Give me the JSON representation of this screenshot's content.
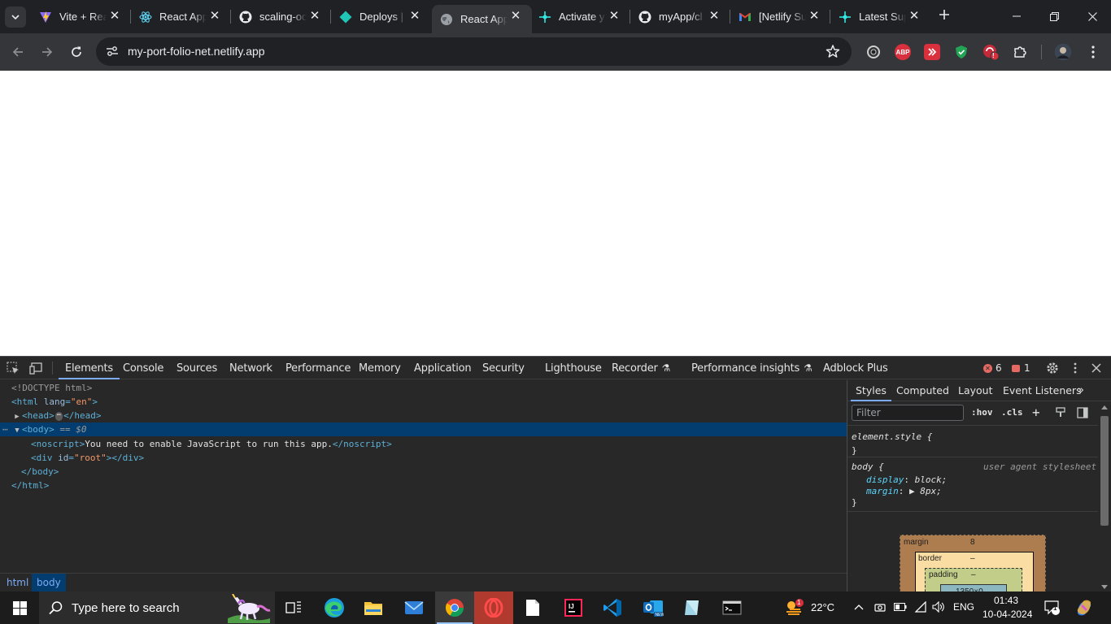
{
  "browser": {
    "tabs": [
      {
        "title": "Vite + React",
        "icon": "vite-icon",
        "active": false
      },
      {
        "title": "React App",
        "icon": "react-icon",
        "active": false
      },
      {
        "title": "scaling-octo",
        "icon": "github-icon",
        "active": false
      },
      {
        "title": "Deploys | ",
        "icon": "netlify-icon",
        "active": false
      },
      {
        "title": "React App",
        "icon": "globe-icon",
        "active": true
      },
      {
        "title": "Activate y",
        "icon": "netlify-sparkle-icon",
        "active": false
      },
      {
        "title": "myApp/cl",
        "icon": "github-icon",
        "active": false
      },
      {
        "title": "[Netlify Su",
        "icon": "gmail-icon",
        "active": false
      },
      {
        "title": "Latest Sup",
        "icon": "netlify-sparkle-icon",
        "active": false
      }
    ],
    "url": "my-port-folio-net.netlify.app",
    "extensions": [
      {
        "name": "profile-ext-icon",
        "label": ""
      },
      {
        "name": "adblock-plus-icon",
        "label": "ABP"
      },
      {
        "name": "red-ext-icon",
        "label": ""
      },
      {
        "name": "shield-ext-icon",
        "label": ""
      },
      {
        "name": "alert-ext-icon",
        "label": "!"
      },
      {
        "name": "extensions-puzzle-icon",
        "label": ""
      }
    ]
  },
  "devtools": {
    "tabs": [
      "Elements",
      "Console",
      "Sources",
      "Network",
      "Performance",
      "Memory",
      "Application",
      "Security",
      "Lighthouse",
      "Recorder",
      "Performance insights",
      "Adblock Plus"
    ],
    "active_tab": "Elements",
    "errors_count": "6",
    "issues_count": "1",
    "dom": {
      "doctype": "<!DOCTYPE html>",
      "html_open_tag": "<html",
      "html_lang_attr": "lang",
      "html_lang_val": "\"en\"",
      "html_open_end": ">",
      "head_open": "<head>",
      "head_ellipsis": "⋯",
      "head_close": "</head>",
      "body_open": "<body>",
      "body_eq": "== $0",
      "noscript_open": "<noscript>",
      "noscript_text": "You need to enable JavaScript to run this app.",
      "noscript_close": "</noscript>",
      "div_open": "<div",
      "div_attr": "id",
      "div_val": "\"root\"",
      "div_close": "></div>",
      "body_close": "</body>",
      "html_close": "</html>",
      "gutter_dots": "⋯"
    },
    "breadcrumbs": [
      "html",
      "body"
    ],
    "styles": {
      "tabs": [
        "Styles",
        "Computed",
        "Layout",
        "Event Listeners"
      ],
      "active_tab": "Styles",
      "filter_placeholder": "Filter",
      "hov": ":hov",
      "cls": ".cls",
      "element_style_selector": "element.style {",
      "close_brace": "}",
      "body_selector": "body {",
      "ua_label": "user agent stylesheet",
      "rules": [
        {
          "prop": "display",
          "value": "block;"
        },
        {
          "prop": "margin",
          "value": "▶ 8px;"
        }
      ]
    },
    "box_model": {
      "margin_label": "margin",
      "margin_value": "8",
      "border_label": "border",
      "border_value": "–",
      "padding_label": "padding",
      "padding_value": "–",
      "content_value": "1350×0"
    }
  },
  "taskbar": {
    "search_placeholder": "Type here to search",
    "weather_temp": "22°C",
    "weather_badge": "1",
    "language": "ENG",
    "time": "01:43",
    "date": "10-04-2024",
    "notification_count": "1"
  }
}
